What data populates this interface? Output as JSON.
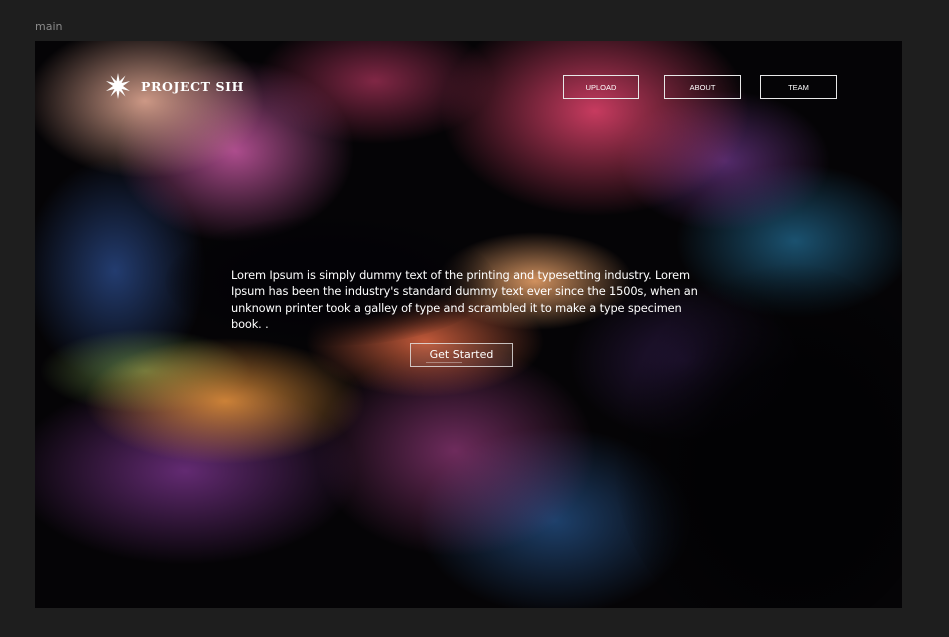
{
  "frame": {
    "label": "main"
  },
  "header": {
    "logo_text": "PROJECT SIH",
    "logo_icon": "starburst-icon",
    "nav": {
      "upload": "UPLOAD",
      "about": "ABOUT",
      "team": "TEAM"
    }
  },
  "hero": {
    "body": "Lorem Ipsum is simply dummy text of the printing and typesetting industry. Lorem Ipsum has been the industry's standard dummy text ever since the 1500s, when an unknown printer took a galley of type and scrambled it to make a type specimen book. .",
    "cta_label": "Get Started"
  },
  "colors": {
    "canvas": "#1e1e1e",
    "frame_base": "#050406",
    "text": "#ffffff",
    "button_border": "#e8e8e8"
  }
}
